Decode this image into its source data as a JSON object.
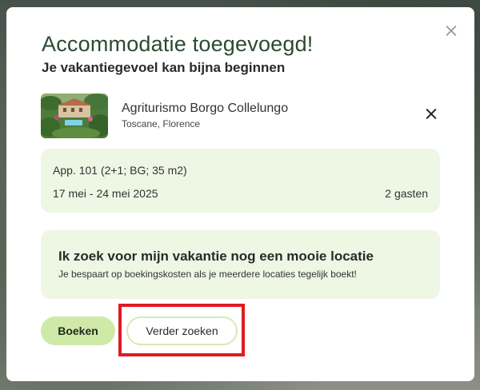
{
  "modal": {
    "title": "Accommodatie toegevoegd!",
    "subtitle": "Je vakantiegevoel kan bijna beginnen"
  },
  "accommodation": {
    "name": "Agriturismo Borgo Collelungo",
    "location": "Toscane, Florence"
  },
  "details": {
    "unit": "App. 101 (2+1; BG; 35 m2)",
    "dates": "17 mei - 24 mei 2025",
    "guests": "2 gasten"
  },
  "promo": {
    "title": "Ik zoek voor mijn vakantie nog een mooie locatie",
    "text": "Je bespaart op boekingskosten als je meerdere locaties tegelijk boekt!"
  },
  "actions": {
    "book_label": "Boeken",
    "search_label": "Verder zoeken"
  },
  "colors": {
    "title": "#2b4a32",
    "card_bg": "#eef6e4",
    "book_button_bg": "#cfe9a8",
    "search_button_border": "#d6eab6",
    "highlight": "#e01b24"
  },
  "icons": {
    "close": "close-icon",
    "remove": "remove-icon"
  }
}
